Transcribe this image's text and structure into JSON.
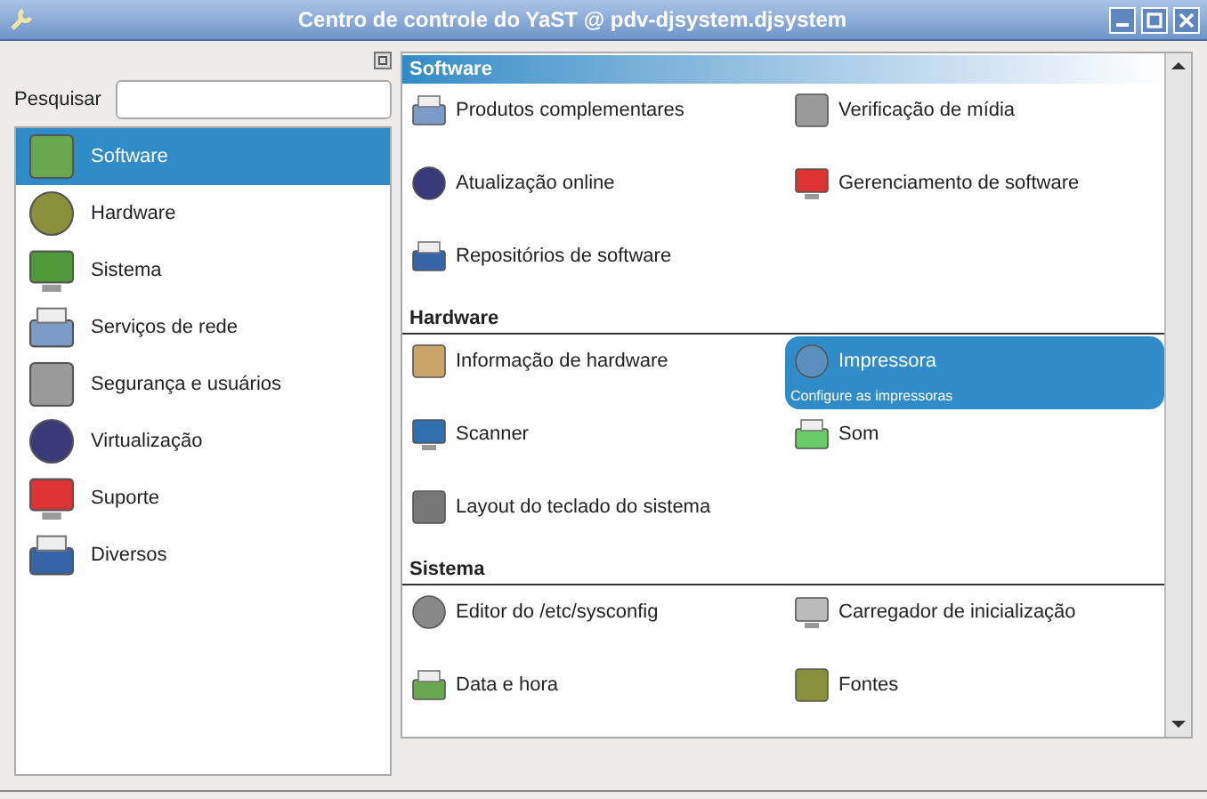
{
  "window": {
    "title": "Centro de controle do YaST @ pdv-djsystem.djsystem"
  },
  "search": {
    "label": "Pesquisar"
  },
  "categories": [
    {
      "label": "Software",
      "selected": true
    },
    {
      "label": "Hardware",
      "selected": false
    },
    {
      "label": "Sistema",
      "selected": false
    },
    {
      "label": "Serviços de rede",
      "selected": false
    },
    {
      "label": "Segurança e usuários",
      "selected": false
    },
    {
      "label": "Virtualização",
      "selected": false
    },
    {
      "label": "Suporte",
      "selected": false
    },
    {
      "label": "Diversos",
      "selected": false
    }
  ],
  "sections": [
    {
      "title": "Software",
      "highlighted": true,
      "items": [
        {
          "label": "Produtos complementares",
          "selected": false
        },
        {
          "label": "Verificação de mídia",
          "selected": false
        },
        {
          "label": "Atualização online",
          "selected": false
        },
        {
          "label": "Gerenciamento de software",
          "selected": false
        },
        {
          "label": "Repositórios de software",
          "selected": false
        }
      ]
    },
    {
      "title": "Hardware",
      "highlighted": false,
      "items": [
        {
          "label": "Informação de hardware",
          "selected": false
        },
        {
          "label": "Impressora",
          "selected": true,
          "description": "Configure as impressoras"
        },
        {
          "label": "Scanner",
          "selected": false
        },
        {
          "label": "Som",
          "selected": false
        },
        {
          "label": "Layout do teclado do sistema",
          "selected": false
        }
      ]
    },
    {
      "title": "Sistema",
      "highlighted": false,
      "items": [
        {
          "label": "Editor do /etc/sysconfig",
          "selected": false
        },
        {
          "label": "Carregador de inicialização",
          "selected": false
        },
        {
          "label": "Data e hora",
          "selected": false
        },
        {
          "label": "Fontes",
          "selected": false
        }
      ]
    }
  ]
}
